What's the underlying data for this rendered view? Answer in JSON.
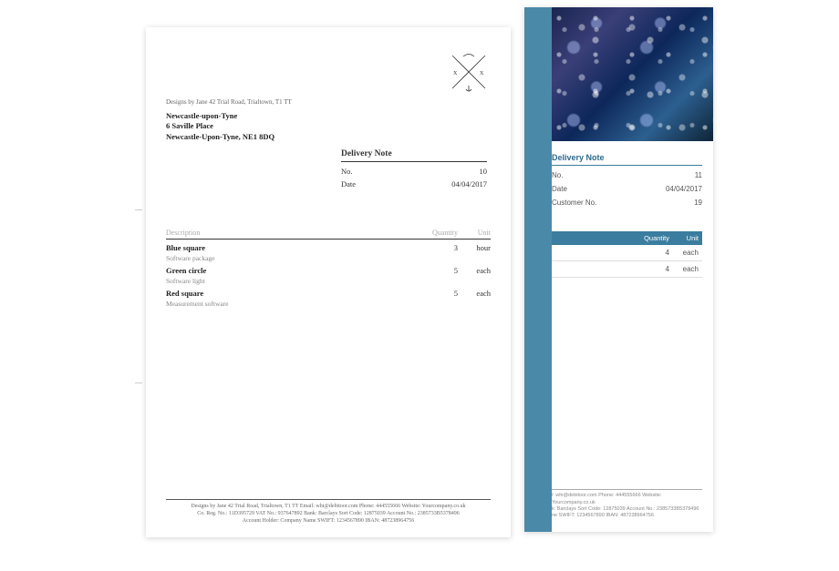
{
  "left": {
    "sender_line": "Designs by Jane 42 Trial Road, Trialtown, T1 TT",
    "recipient": {
      "line1": "Newcastle-upon-Tyne",
      "line2": "6 Saville Place",
      "line3": "Newcastle-Upon-Tyne, NE1 8DQ"
    },
    "delivery_note": {
      "title": "Delivery Note",
      "no_label": "No.",
      "no_value": "10",
      "date_label": "Date",
      "date_value": "04/04/2017"
    },
    "columns": {
      "description": "Description",
      "quantity": "Quantity",
      "unit": "Unit"
    },
    "items": [
      {
        "name": "Blue square",
        "sub": "Software package",
        "qty": "3",
        "unit": "hour"
      },
      {
        "name": "Green circle",
        "sub": "Software light",
        "qty": "5",
        "unit": "each"
      },
      {
        "name": "Red square",
        "sub": "Measurement software",
        "qty": "5",
        "unit": "each"
      }
    ],
    "footer": {
      "line1": "Designs by Jane    42 Trial Road, Trialtown, T1 TT    Email: whi@debitoor.com    Phone: 444555666    Website: Yourcompany.co.uk",
      "line2": "Co. Reg. No.: 11D395729    VAT No.: 937647892    Bank: Barclays    Sort Code: 12875039    Account No.: 2385733B5378496",
      "line3": "Account Holder: Company Name    SWIFT: 1234567890    IBAN: 487238964756"
    }
  },
  "right": {
    "delivery_note": {
      "title": "Delivery Note",
      "no_label": "No.",
      "no_value": "11",
      "date_label": "Date",
      "date_value": "04/04/2017",
      "customer_label": "Customer No.",
      "customer_value": "19"
    },
    "columns": {
      "quantity": "Quantity",
      "unit": "Unit"
    },
    "items": [
      {
        "qty": "4",
        "unit": "each"
      },
      {
        "qty": "4",
        "unit": "each"
      }
    ],
    "footer": {
      "line1": "l: whi@debitoor.com    Phone: 444555666    Website: Yourcompany.co.uk",
      "line2": "k: Barclays    Sort Code: 12875039    Account No.: 2385733B5378496",
      "line3": "ne    SWIFT: 1234567890    IBAN: 487238964756"
    }
  }
}
